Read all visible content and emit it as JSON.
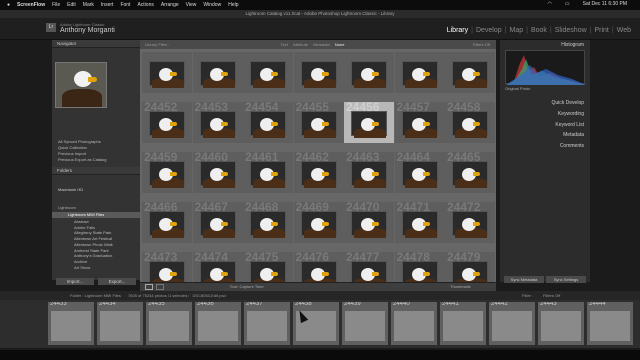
{
  "menubar": {
    "app": "ScreenFlow",
    "items": [
      "File",
      "Edit",
      "Mark",
      "Insert",
      "Font",
      "Actions",
      "Arrange",
      "View",
      "Window",
      "Help"
    ],
    "clock": "Sat Dec 11  6:30 PM"
  },
  "titlebar": {
    "title": "Lightroom Catalog v11.lrcat - Adobe Photoshop Lightroom Classic - Library"
  },
  "identity": {
    "line1": "Adobe Lightroom Classic",
    "line2": "Anthony Morganti"
  },
  "modules": [
    "Library",
    "Develop",
    "Map",
    "Book",
    "Slideshow",
    "Print",
    "Web"
  ],
  "left": {
    "navigator": "Navigator",
    "catalog_items": [
      "All Synced Photographs",
      "Quick Collection",
      "Previous Import",
      "Previous Export as Catalog"
    ],
    "folders_title": "Folders",
    "volume": "Macintosh HD",
    "drive": "Lightroom",
    "root": "Lightroom MMI Files",
    "subfolders": [
      "Abstract",
      "Adobe Falls",
      "Allegheny State Park",
      "Allentown Art Festival",
      "Allentown Photo Walk",
      "Amherst State Park",
      "Anthony's Graduation",
      "Archive",
      "Art Show"
    ],
    "import": "Import...",
    "export": "Export..."
  },
  "filterbar": {
    "title": "Library Filter :",
    "opts": [
      "Text",
      "Attribute",
      "Metadata",
      "None"
    ],
    "custom": "Filters Off"
  },
  "grid": [
    {
      "n": "",
      "sel": false
    },
    {
      "n": "",
      "sel": false
    },
    {
      "n": "",
      "sel": false
    },
    {
      "n": "",
      "sel": false
    },
    {
      "n": "",
      "sel": false
    },
    {
      "n": "",
      "sel": false
    },
    {
      "n": "",
      "sel": false
    },
    {
      "n": "24452",
      "sel": false
    },
    {
      "n": "24453",
      "sel": false
    },
    {
      "n": "24454",
      "sel": false
    },
    {
      "n": "24455",
      "sel": false
    },
    {
      "n": "24456",
      "sel": true
    },
    {
      "n": "24457",
      "sel": false
    },
    {
      "n": "24458",
      "sel": false
    },
    {
      "n": "24459",
      "sel": false
    },
    {
      "n": "24460",
      "sel": false
    },
    {
      "n": "24461",
      "sel": false
    },
    {
      "n": "24462",
      "sel": false
    },
    {
      "n": "24463",
      "sel": false
    },
    {
      "n": "24464",
      "sel": false
    },
    {
      "n": "24465",
      "sel": false
    },
    {
      "n": "24466",
      "sel": false
    },
    {
      "n": "24467",
      "sel": false
    },
    {
      "n": "24468",
      "sel": false
    },
    {
      "n": "24469",
      "sel": false
    },
    {
      "n": "24470",
      "sel": false
    },
    {
      "n": "24471",
      "sel": false
    },
    {
      "n": "24472",
      "sel": false
    },
    {
      "n": "24473",
      "sel": false
    },
    {
      "n": "24474",
      "sel": false
    },
    {
      "n": "24475",
      "sel": false
    },
    {
      "n": "24476",
      "sel": false
    },
    {
      "n": "24477",
      "sel": false
    },
    {
      "n": "24478",
      "sel": false
    },
    {
      "n": "24479",
      "sel": false
    }
  ],
  "right": {
    "histogram": "Histogram",
    "original": "Original Photo",
    "quick_develop": "Quick Develop",
    "keywording": "Keywording",
    "keyword_list": "Keyword List",
    "metadata": "Metadata",
    "comments": "Comments",
    "sync": "Sync Metadata",
    "sync2": "Sync Settings"
  },
  "toolbar": {
    "sort": "Sort: Capture Time",
    "thumbs": "Thumbnails"
  },
  "filmstrip_header": {
    "path": "Folder : Lightroom MMI Files",
    "count": "7605 of 75244 photos /1 selected /",
    "file": "DSC8053-Edit.psd",
    "filter": "Filter :",
    "filter_val": "Filters Off"
  },
  "filmstrip": [
    "24433",
    "24434",
    "24435",
    "24436",
    "24437",
    "24438",
    "24439",
    "24440",
    "24441",
    "24442",
    "24443",
    "24444"
  ],
  "colors": {
    "accent": "#e0a20d",
    "selected": "#b8b8b8",
    "panel": "#333333"
  }
}
